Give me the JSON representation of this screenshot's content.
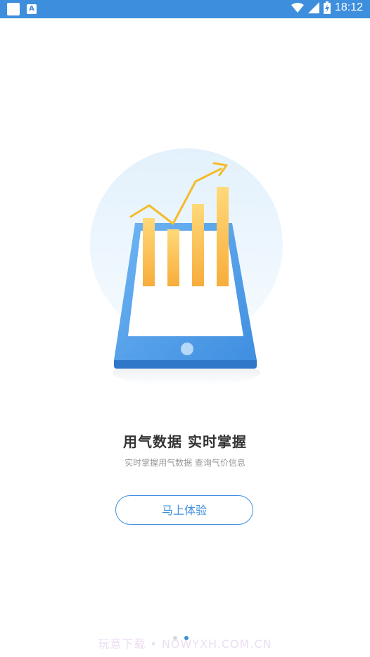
{
  "status_bar": {
    "time": "18:12",
    "icons": [
      "notification-square-icon",
      "app-a-icon",
      "wifi-icon",
      "signal-icon",
      "battery-charging-icon"
    ]
  },
  "onboarding": {
    "title": "用气数据  实时掌握",
    "subtitle": "实时掌握用气数据  查询气价信息",
    "cta_label": "马上体验",
    "page_index": 2,
    "page_count": 2
  },
  "watermark": "玩意下载 • NOWYXH.COM.CN",
  "colors": {
    "accent": "#3d8fdd",
    "bar": "#f8b84a",
    "line": "#f5bb2a",
    "circle_bg": "#e8f3fd"
  }
}
